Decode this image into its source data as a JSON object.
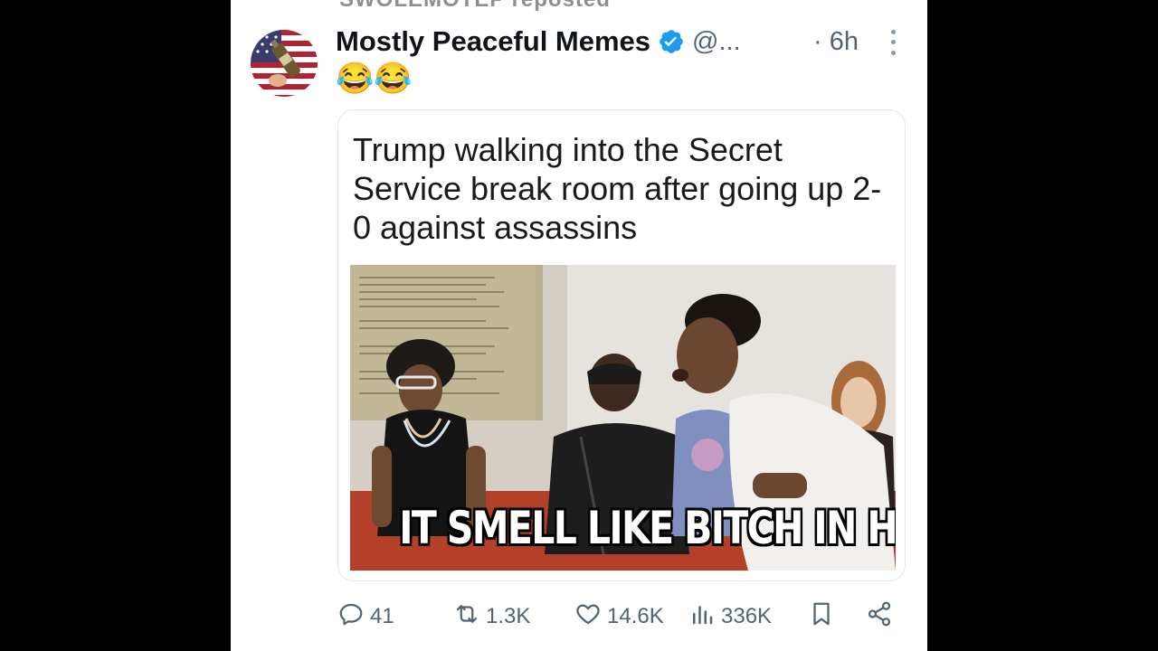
{
  "top_cut_text": "SWOLEMOTEP reposted",
  "post": {
    "author_name": "Mostly Peaceful Memes",
    "handle": "@...",
    "time": "· 6h",
    "text": "😂😂",
    "card_caption": "Trump walking into the Secret Service break room after going up 2-0 against assassins",
    "meme_text": "IT SMELL LIKE BITCH IN HERE"
  },
  "actions": {
    "replies": "41",
    "reposts": "1.3K",
    "likes": "14.6K",
    "views": "336K"
  },
  "icons": [
    "verified-badge-icon",
    "more-icon",
    "reply-icon",
    "repost-icon",
    "like-icon",
    "views-icon",
    "bookmark-icon",
    "share-icon"
  ],
  "colors": {
    "verified": "#1d9bf0",
    "secondary_text": "#536471"
  }
}
